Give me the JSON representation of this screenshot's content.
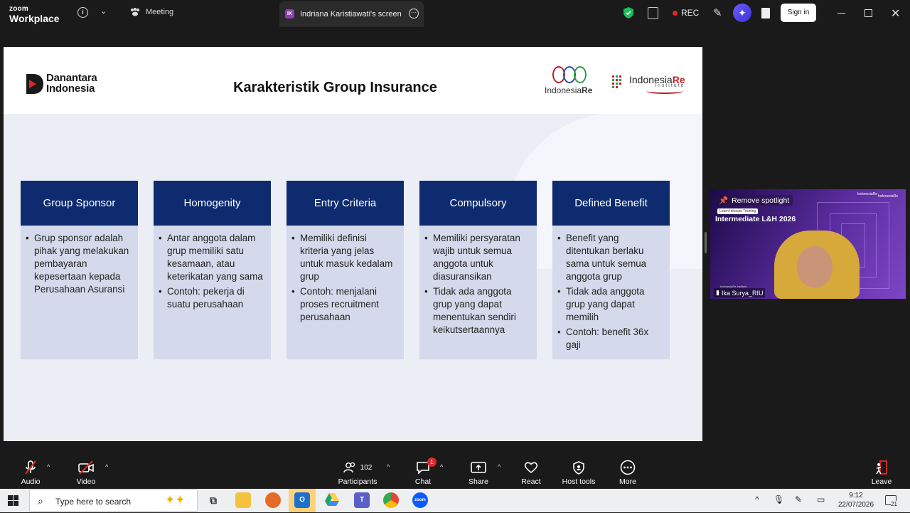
{
  "app": {
    "logo_line1": "zoom",
    "logo_line2": "Workplace",
    "meeting_tab": "Meeting",
    "screen_tab_initials": "IK",
    "screen_tab_title": "Indriana Karistiawati's screen",
    "rec_label": "REC",
    "sign_in": "Sign in"
  },
  "slide": {
    "org_line1": "Danantara",
    "org_line2": "Indonesia",
    "title": "Karakteristik Group Insurance",
    "logo_ire_1": "Indonesia",
    "logo_ire_2": "Re",
    "logo_iri_1": "Indonesia",
    "logo_iri_2": "Re",
    "logo_iri_sub": "Institute",
    "cards": [
      {
        "title": "Group Sponsor",
        "points": [
          "Grup sponsor adalah pihak yang melakukan pembayaran kepesertaan kepada Perusahaan Asuransi"
        ]
      },
      {
        "title": "Homogenity",
        "points": [
          "Antar anggota dalam grup memiliki satu kesamaan, atau keterikatan yang sama",
          "Contoh: pekerja di suatu perusahaan"
        ]
      },
      {
        "title": "Entry Criteria",
        "points": [
          "Memiliki definisi kriteria yang jelas untuk masuk kedalam grup",
          "Contoh: menjalani proses recruitment perusahaan"
        ]
      },
      {
        "title": "Compulsory",
        "points": [
          "Memiliki persyaratan wajib untuk semua anggota untuk diasuransikan",
          "Tidak ada anggota grup yang dapat menentukan sendiri keikutsertaannya"
        ]
      },
      {
        "title": "Defined Benefit",
        "points": [
          "Benefit yang ditentukan berlaku sama untuk semua anggota grup",
          "Tidak ada anggota grup yang dapat memilih",
          "Contoh: benefit 36x gaji"
        ]
      }
    ]
  },
  "speaker": {
    "remove_spotlight": "Remove spotlight",
    "tag": "Learn Inhouse Training",
    "title": "Intermediate L&H 2026",
    "name": "Ika Surya_RIU",
    "small_caption": "IndonesiaRe Institute",
    "logo1": "IndonesiaRe",
    "logo2": "IndonesiaRe"
  },
  "toolbar": {
    "audio": "Audio",
    "video": "Video",
    "participants": "Participants",
    "participants_count": "102",
    "chat": "Chat",
    "chat_badge": "1",
    "share": "Share",
    "react": "React",
    "host_tools": "Host tools",
    "more": "More",
    "leave": "Leave"
  },
  "taskbar": {
    "search_placeholder": "Type here to search",
    "time": "9:12",
    "date": "22/07/2026",
    "notifications": "21"
  },
  "colors": {
    "card_header": "#0d2b6e",
    "card_body": "#d4d9eb",
    "rec_dot": "#e02828",
    "brand_red": "#c41e28"
  }
}
